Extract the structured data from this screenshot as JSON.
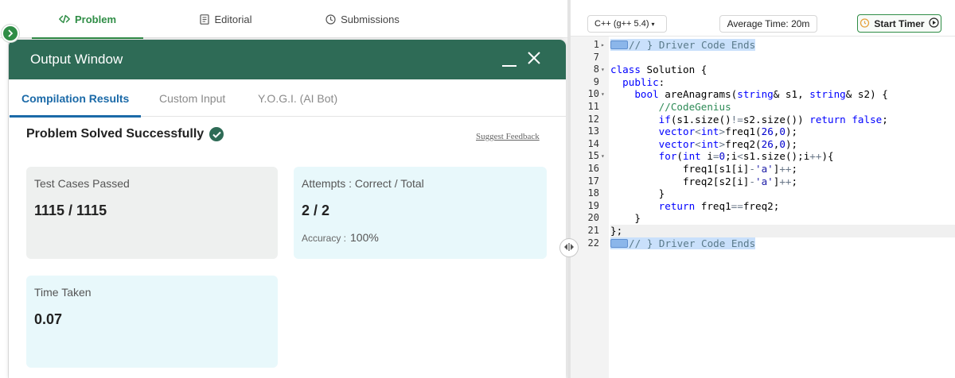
{
  "tabs": [
    {
      "label": "Problem",
      "icon": "code-icon"
    },
    {
      "label": "Editorial",
      "icon": "document-icon"
    },
    {
      "label": "Submissions",
      "icon": "clock-icon"
    }
  ],
  "output_window": {
    "title": "Output Window",
    "tabs": [
      "Compilation Results",
      "Custom Input",
      "Y.O.G.I. (AI Bot)"
    ],
    "status": "Problem Solved Successfully",
    "suggest_feedback": "Suggest Feedback",
    "cards": {
      "test_cases": {
        "label": "Test Cases Passed",
        "value": "1115 / 1115"
      },
      "attempts": {
        "label": "Attempts : Correct / Total",
        "value": "2 / 2",
        "accuracy_label": "Accuracy :",
        "accuracy_value": "100%"
      },
      "time_taken": {
        "label": "Time Taken",
        "value": "0.07"
      }
    }
  },
  "editor": {
    "language": "C++ (g++ 5.4)",
    "average_time": "Average Time: 20m",
    "start_timer": "Start Timer",
    "lines": [
      {
        "num": "1",
        "code": "// } Driver Code Ends",
        "selected": true,
        "fold": "▸"
      },
      {
        "num": "7",
        "code": ""
      },
      {
        "num": "8",
        "code": "class Solution {",
        "fold": "▾"
      },
      {
        "num": "9",
        "code": "  public:"
      },
      {
        "num": "10",
        "code": "    bool areAnagrams(string& s1, string& s2) {",
        "fold": "▾"
      },
      {
        "num": "11",
        "code": "        //CodeGenius"
      },
      {
        "num": "12",
        "code": "        if(s1.size()!=s2.size()) return false;"
      },
      {
        "num": "13",
        "code": "        vector<int>freq1(26,0);"
      },
      {
        "num": "14",
        "code": "        vector<int>freq2(26,0);"
      },
      {
        "num": "15",
        "code": "        for(int i=0;i<s1.size();i++){",
        "fold": "▾"
      },
      {
        "num": "16",
        "code": "            freq1[s1[i]-'a']++;"
      },
      {
        "num": "17",
        "code": "            freq2[s2[i]-'a']++;"
      },
      {
        "num": "18",
        "code": "        }"
      },
      {
        "num": "19",
        "code": "        return freq1==freq2;"
      },
      {
        "num": "20",
        "code": "    }"
      },
      {
        "num": "21",
        "code": "};",
        "highlight": true
      },
      {
        "num": "22",
        "code": "// } Driver Code Ends",
        "selected": true
      }
    ]
  },
  "colors": {
    "brand_green": "#2f8d46",
    "header_green": "#2e6b56",
    "active_blue": "#1b6aa8",
    "selection": "#c9e0fb"
  }
}
